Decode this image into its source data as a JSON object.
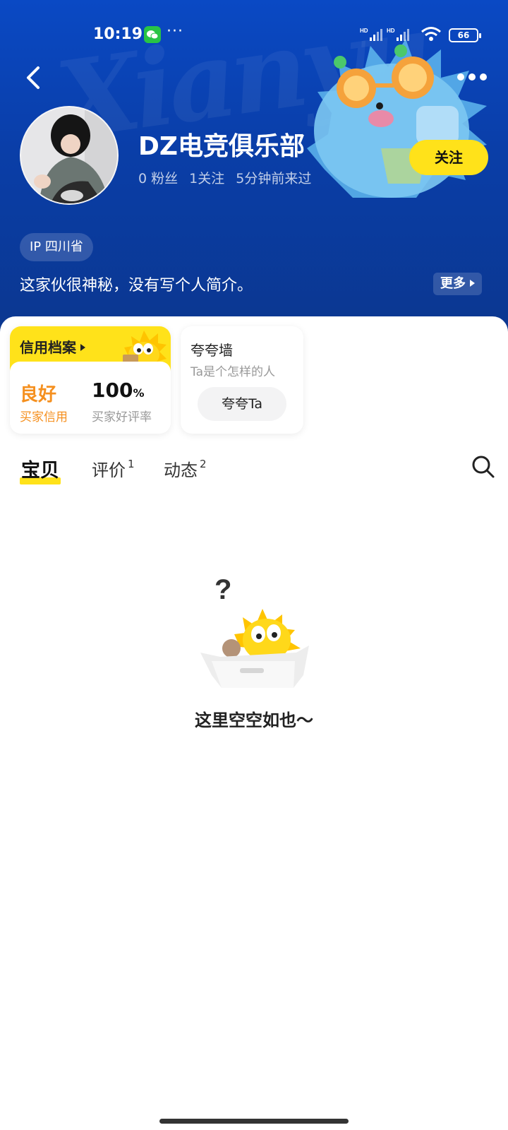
{
  "status_bar": {
    "time": "10:19",
    "signal_badge": "HD",
    "battery": "66",
    "overflow": "···"
  },
  "header": {
    "watermark": "Xianyu",
    "user_name": "DZ电竞俱乐部",
    "fans": "0 粉丝",
    "following": "1关注",
    "last_seen": "5分钟前来过",
    "follow_label": "关注",
    "ip_location": "IP 四川省",
    "bio": "这家伙很神秘，没有写个人简介。",
    "more_label": "更多"
  },
  "credit_card": {
    "title": "信用档案",
    "grade": "良好",
    "grade_label": "买家信用",
    "rate": "100",
    "rate_unit": "%",
    "rate_label": "买家好评率"
  },
  "praise_card": {
    "title": "夸夸墙",
    "subtitle": "Ta是个怎样的人",
    "button_label": "夸夸Ta"
  },
  "tabs": [
    {
      "label": "宝贝",
      "count": ""
    },
    {
      "label": "评价",
      "count": "1"
    },
    {
      "label": "动态",
      "count": "2"
    }
  ],
  "empty_state": {
    "text": "这里空空如也～"
  },
  "colors": {
    "brand_yellow": "#ffe21a",
    "header_blue": "#0a3ea8",
    "credit_orange": "#f5901f"
  }
}
